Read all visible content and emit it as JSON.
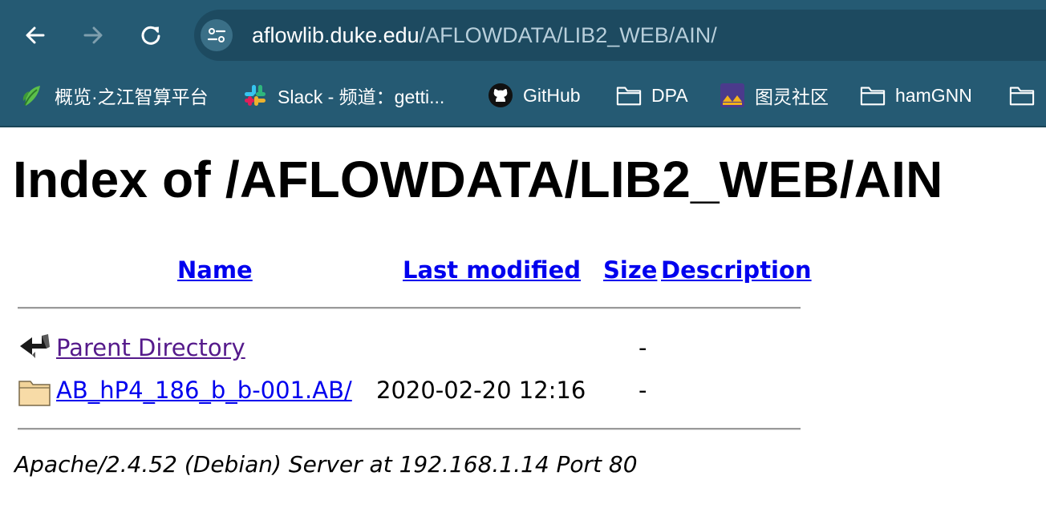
{
  "browser": {
    "url_host": "aflowlib.duke.edu",
    "url_path": "/AFLOWDATA/LIB2_WEB/AIN/",
    "bookmarks": [
      {
        "label": "概览·之江智算平台",
        "icon": "leaf-icon"
      },
      {
        "label": "Slack - 频道：getti...",
        "icon": "slack-icon"
      },
      {
        "label": "GitHub",
        "icon": "github-icon"
      },
      {
        "label": "DPA",
        "icon": "folder-icon"
      },
      {
        "label": "图灵社区",
        "icon": "turing-icon"
      },
      {
        "label": "hamGNN",
        "icon": "folder-icon"
      }
    ]
  },
  "page": {
    "title": "Index of /AFLOWDATA/LIB2_WEB/AIN",
    "columns": {
      "name": "Name",
      "last_modified": "Last modified",
      "size": "Size",
      "description": "Description"
    },
    "rows": [
      {
        "icon": "back-arrow-icon",
        "name": "Parent Directory",
        "modified": "",
        "size": "-",
        "visited": true
      },
      {
        "icon": "folder-icon",
        "name": "AB_hP4_186_b_b-001.AB/",
        "modified": "2020-02-20 12:16",
        "size": "-",
        "visited": false
      }
    ],
    "footer": "Apache/2.4.52 (Debian) Server at 192.168.1.14 Port 80"
  }
}
